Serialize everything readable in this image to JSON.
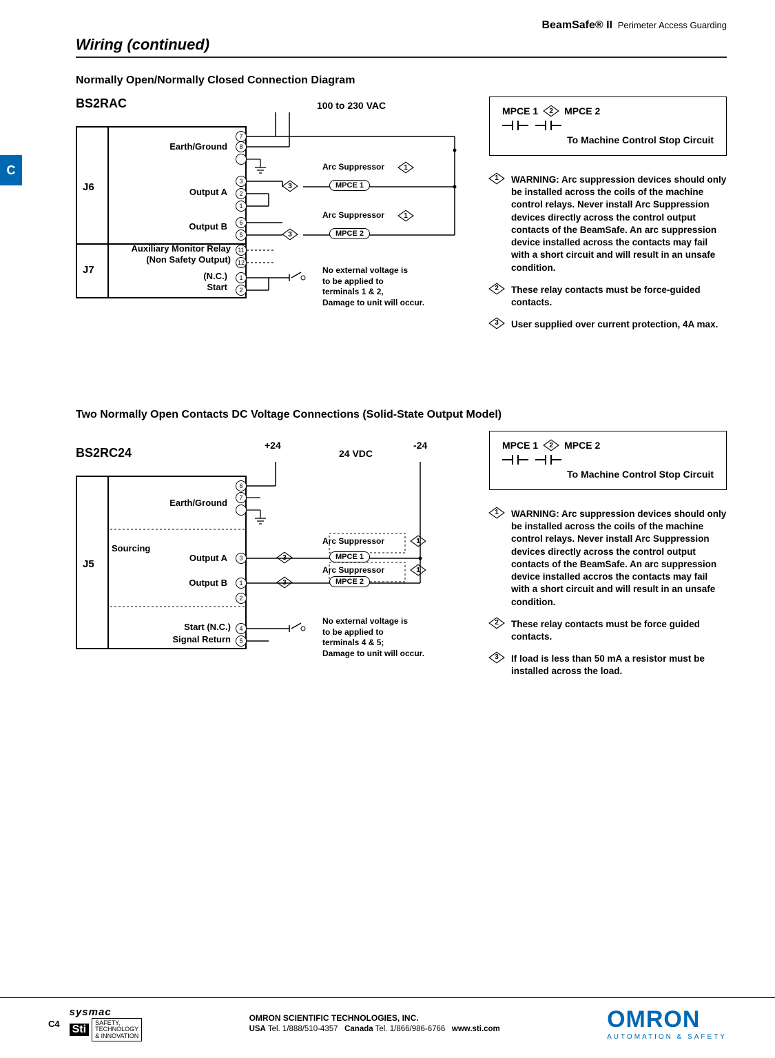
{
  "header": {
    "product": "BeamSafe® II",
    "tagline": "Perimeter Access Guarding"
  },
  "section_title": "Wiring (continued)",
  "side_tab": "C",
  "diagram1": {
    "title": "Normally Open/Normally Closed Connection Diagram",
    "model": "BS2RAC",
    "supply": "100 to 230 VAC",
    "connectors": {
      "J6": "J6",
      "J7": "J7"
    },
    "signals": {
      "earth": "Earth/Ground",
      "outA": "Output A",
      "outB": "Output B",
      "aux1": "Auxiliary Monitor Relay",
      "aux2": "(Non Safety Output)",
      "nc": "(N.C.)",
      "start": "Start"
    },
    "terminals": {
      "j6": [
        "7",
        "8",
        "3",
        "2",
        "1",
        "6",
        "5"
      ],
      "j7": [
        "11",
        "12",
        "1",
        "2"
      ]
    },
    "mpce1": "MPCE 1",
    "mpce2": "MPCE 2",
    "arc": "Arc Suppressor",
    "d1": "1",
    "d3": "3",
    "note": "No external voltage is\nto be applied to\nterminals 1 & 2,\nDamage to unit will occur."
  },
  "diagram2": {
    "title": "Two Normally Open Contacts DC Voltage Connections (Solid-State Output Model)",
    "model": "BS2RC24",
    "supply": "24 VDC",
    "plus": "+24",
    "minus": "-24",
    "connectors": {
      "J5": "J5"
    },
    "signals": {
      "earth": "Earth/Ground",
      "sourcing": "Sourcing",
      "outA": "Output A",
      "outB": "Output B",
      "startnc": "Start (N.C.)",
      "sigret": "Signal Return"
    },
    "terminals": {
      "j5": [
        "6",
        "7",
        "3",
        "1",
        "2",
        "4",
        "5"
      ]
    },
    "mpce1": "MPCE 1",
    "mpce2": "MPCE 2",
    "arc": "Arc Suppressor",
    "d1": "1",
    "d3": "3",
    "note": "No external voltage is\nto be applied to\nterminals 4 & 5;\nDamage to unit will occur."
  },
  "right1": {
    "mpce1": "MPCE 1",
    "mpce2": "MPCE 2",
    "d2": "2",
    "to": "To Machine Control Stop Circuit",
    "warn1": "WARNING: Arc suppression devices should only be installed across the coils of the machine control relays. Never install Arc Suppression devices directly across the control output contacts of the BeamSafe. An arc suppression device installed across the contacts may fail with a short circuit and will result in an unsafe condition.",
    "warn2": "These relay contacts must be force-guided contacts.",
    "warn3": "User supplied over current protection, 4A max."
  },
  "right2": {
    "mpce1": "MPCE 1",
    "mpce2": "MPCE 2",
    "d2": "2",
    "to": "To Machine Control Stop Circuit",
    "warn1": "WARNING: Arc suppression devices should only be installed  across the coils of the machine control relays. Never install Arc Suppression devices directly across the control output contacts of the BeamSafe. An arc suppression device installed accros the contacts may fail with a short circuit and will result in an unsafe condition.",
    "warn2": "These relay contacts must be force guided contacts.",
    "warn3": "If load is less than 50 mA a resistor must be installed across the load."
  },
  "footer": {
    "page": "C4",
    "sysmac": "sysmac",
    "sti1": "SAFETY,",
    "sti2": "TECHNOLOGY",
    "sti3": "& INNOVATION",
    "company": "OMRON SCIENTIFIC TECHNOLOGIES, INC.",
    "usa_lbl": "USA",
    "usa_tel": "Tel. 1/888/510-4357",
    "can_lbl": "Canada",
    "can_tel": "Tel. 1/866/986-6766",
    "site": "www.sti.com",
    "omron": "OMRON",
    "omron_sub": "AUTOMATION & SAFETY"
  }
}
